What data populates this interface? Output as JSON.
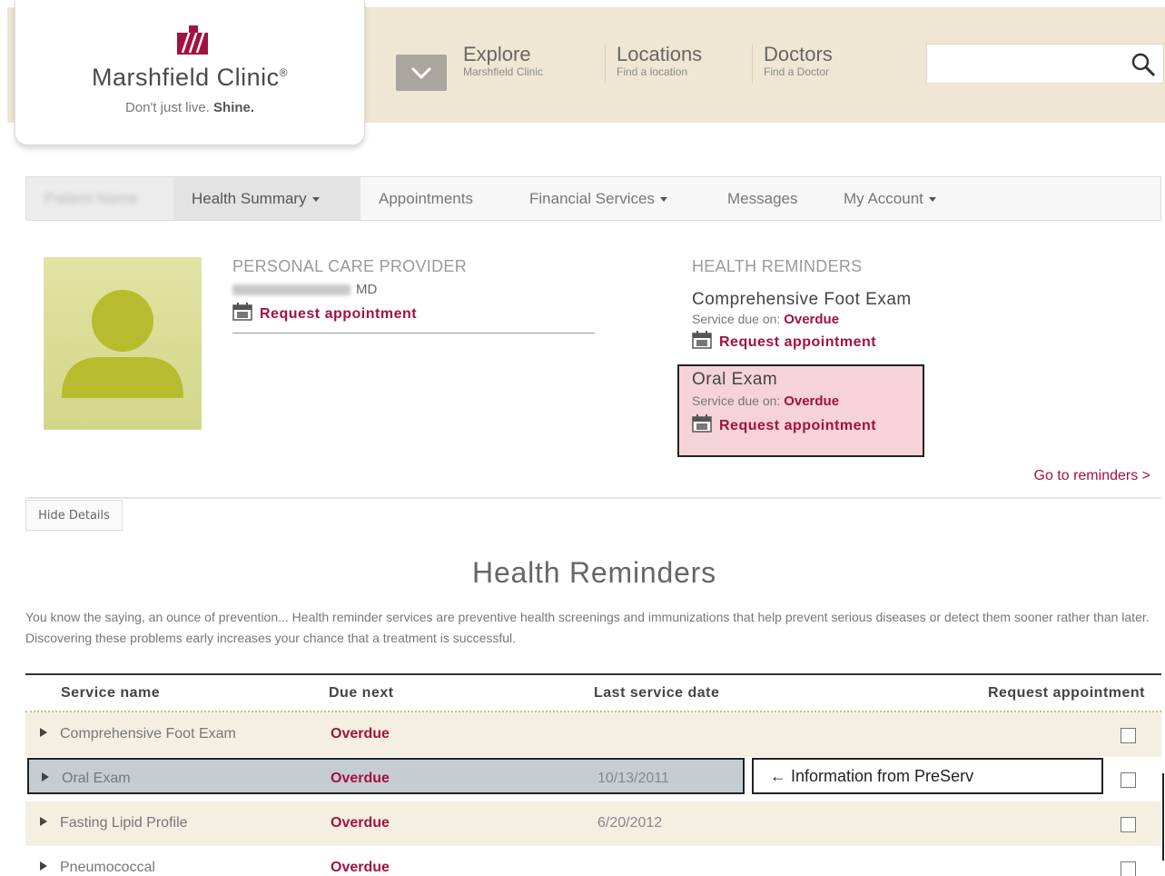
{
  "brand": {
    "name": "Marshfield Clinic",
    "trademark": "®",
    "tagline_prefix": "Don't just live.",
    "tagline_emphasis": "Shine.",
    "logo_color": "#a3123e"
  },
  "topnav": {
    "explore": {
      "label": "Explore",
      "sub": "Marshfield Clinic"
    },
    "locations": {
      "label": "Locations",
      "sub": "Find a location"
    },
    "doctors": {
      "label": "Doctors",
      "sub": "Find a Doctor"
    },
    "search_placeholder": ""
  },
  "tabs": {
    "user": "Patient Name",
    "health_summary": "Health Summary",
    "appointments": "Appointments",
    "financial": "Financial Services",
    "messages": "Messages",
    "account": "My Account"
  },
  "provider": {
    "label": "PERSONAL CARE PROVIDER",
    "credential": "MD",
    "request": "Request appointment"
  },
  "reminders_card": {
    "label": "HEALTH REMINDERS",
    "due_prefix": "Service due on:",
    "items": [
      {
        "title": "Comprehensive Foot Exam",
        "status": "Overdue",
        "request": "Request appointment"
      },
      {
        "title": "Oral Exam",
        "status": "Overdue",
        "request": "Request appointment"
      }
    ],
    "goto": "Go to reminders >"
  },
  "hide_details": "Hide Details",
  "page_heading": "Health Reminders",
  "intro_text": "You know the saying, an ounce of prevention... Health reminder services are preventive health screenings and immunizations that help prevent serious diseases or detect them sooner rather than later. Discovering these problems early increases your chance that a treatment is successful.",
  "table": {
    "headers": {
      "service": "Service name",
      "due": "Due next",
      "last": "Last service date",
      "request": "Request appointment"
    },
    "rows": [
      {
        "service": "Comprehensive Foot Exam",
        "due": "Overdue",
        "last": "",
        "checked": false
      },
      {
        "service": "Oral Exam",
        "due": "Overdue",
        "last": "10/13/2011",
        "checked": false
      },
      {
        "service": "Fasting Lipid Profile",
        "due": "Overdue",
        "last": "6/20/2012",
        "checked": false
      },
      {
        "service": "Pneumococcal",
        "due": "Overdue",
        "last": "",
        "checked": false
      }
    ],
    "annotation": "← Information from PreServ"
  }
}
